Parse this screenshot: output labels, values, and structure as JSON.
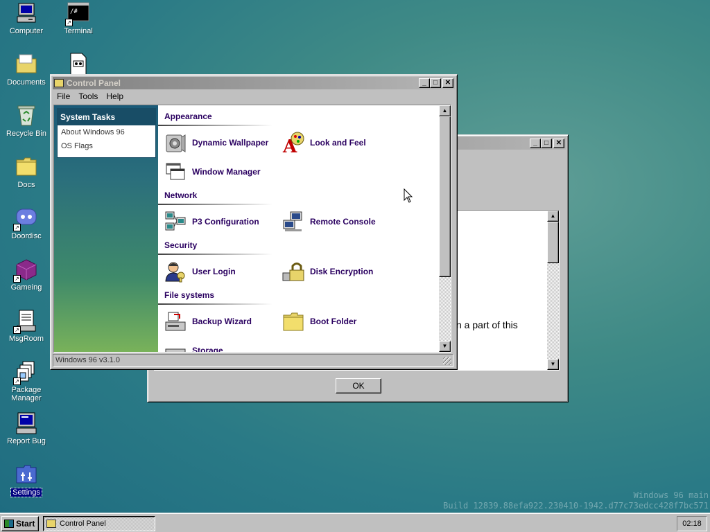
{
  "desktop": {
    "icons": [
      {
        "label": "Computer"
      },
      {
        "label": "Terminal"
      },
      {
        "label": "Documents"
      },
      {
        "label": "Recycle Bin"
      },
      {
        "label": "Docs"
      },
      {
        "label": "Doordisc"
      },
      {
        "label": "Gameing"
      },
      {
        "label": "MsgRoom"
      },
      {
        "label": "Package Manager"
      },
      {
        "label": "Report Bug"
      },
      {
        "label": "Settings"
      }
    ],
    "watermark": {
      "line1": "Windows 96 main",
      "line2": "Build 12839.88efa922.230410-1942.d77c73edcc428f7bc571"
    }
  },
  "back_window": {
    "partial_text": "n a part of this",
    "ok_label": "OK"
  },
  "control_panel": {
    "title": "Control Panel",
    "menu": [
      "File",
      "Tools",
      "Help"
    ],
    "system_tasks": {
      "header": "System Tasks",
      "items": [
        "About Windows 96",
        "OS Flags"
      ]
    },
    "sections": [
      {
        "name": "Appearance",
        "items": [
          {
            "label": "Dynamic Wallpaper",
            "icon": "speaker-icon"
          },
          {
            "label": "Look and Feel",
            "icon": "paint-palette-icon"
          },
          {
            "label": "Window Manager",
            "icon": "windows-stack-icon"
          }
        ]
      },
      {
        "name": "Network",
        "items": [
          {
            "label": "P3 Configuration",
            "icon": "network-computers-icon"
          },
          {
            "label": "Remote Console",
            "icon": "remote-computers-icon"
          }
        ]
      },
      {
        "name": "Security",
        "items": [
          {
            "label": "User Login",
            "icon": "user-key-icon"
          },
          {
            "label": "Disk Encryption",
            "icon": "padlock-drive-icon"
          }
        ]
      },
      {
        "name": "File systems",
        "items": [
          {
            "label": "Backup Wizard",
            "icon": "backup-drive-icon"
          },
          {
            "label": "Boot Folder",
            "icon": "folder-icon"
          },
          {
            "label": "Storage",
            "icon": "storage-icon"
          }
        ]
      }
    ],
    "status": "Windows 96 v3.1.0"
  },
  "taskbar": {
    "start_label": "Start",
    "task_label": "Control Panel",
    "clock": "02:18"
  },
  "colors": {
    "accent": "#184d66",
    "title_active": "#808080",
    "label_text": "#2a0060"
  }
}
